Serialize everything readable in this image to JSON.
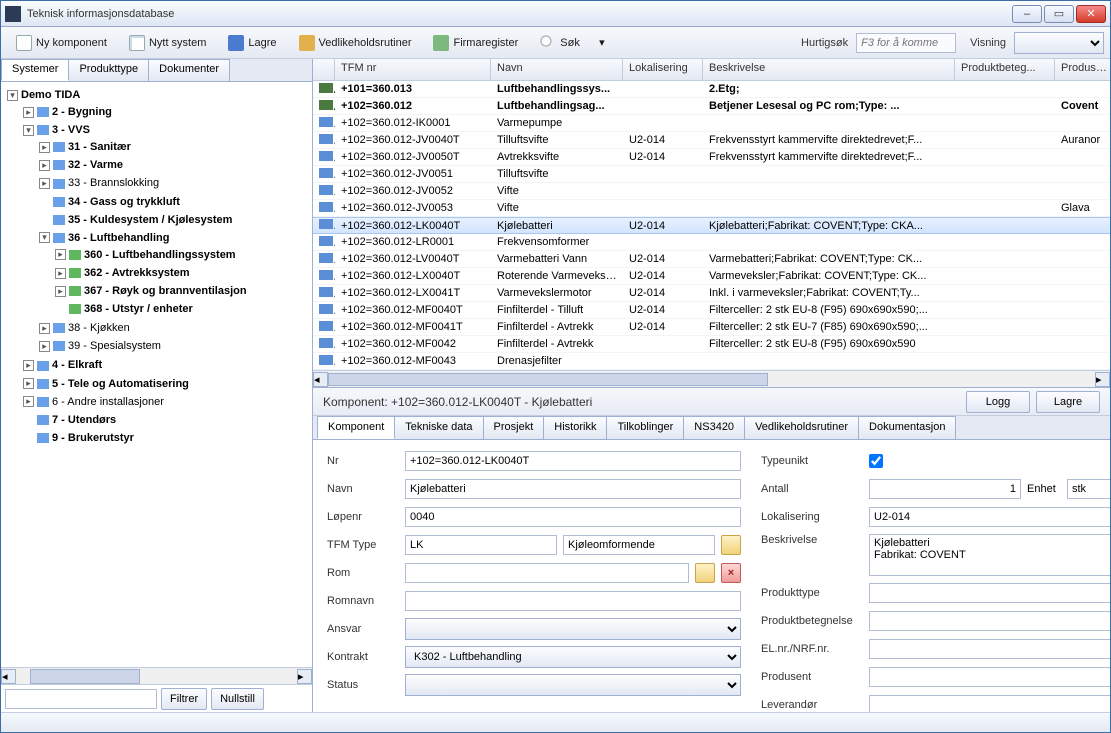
{
  "window": {
    "title": "Teknisk informasjonsdatabase"
  },
  "toolbar": {
    "new_component": "Ny komponent",
    "new_system": "Nytt system",
    "save": "Lagre",
    "maintenance": "Vedlikeholdsrutiner",
    "firm_register": "Firmaregister",
    "search": "Søk",
    "hurtigsok_label": "Hurtigsøk",
    "hurtigsok_placeholder": "F3 for å komme",
    "visning_label": "Visning"
  },
  "left_tabs": [
    "Systemer",
    "Produkttype",
    "Dokumenter"
  ],
  "tree": {
    "root": "Demo TIDA",
    "n2": "2 - Bygning",
    "n3": "3 - VVS",
    "n31": "31 - Sanitær",
    "n32": "32 - Varme",
    "n33": "33 - Brannslokking",
    "n34": "34 - Gass og trykkluft",
    "n35": "35 - Kuldesystem / Kjølesystem",
    "n36": "36 - Luftbehandling",
    "n360": "360 - Luftbehandlingssystem",
    "n362": "362 - Avtrekksystem",
    "n367": "367 - Røyk og brannventilasjon",
    "n368": "368 - Utstyr / enheter",
    "n38": "38 - Kjøkken",
    "n39": "39 - Spesialsystem",
    "n4": "4 - Elkraft",
    "n5": "5 - Tele og Automatisering",
    "n6": "6 - Andre installasjoner",
    "n7": "7 - Utendørs",
    "n9": "9 - Brukerutstyr"
  },
  "leftfoot": {
    "filter": "Filtrer",
    "reset": "Nullstill"
  },
  "grid": {
    "headers": {
      "tfm": "TFM nr",
      "navn": "Navn",
      "lok": "Lokalisering",
      "besk": "Beskrivelse",
      "prodb": "Produktbeteg...",
      "produ": "Produsent"
    },
    "rows": [
      {
        "sys": true,
        "tfm": "+101=360.013",
        "navn": "Luftbehandlingssys...",
        "lok": "",
        "besk": "2.Etg;",
        "produ": ""
      },
      {
        "sys": true,
        "tfm": "+102=360.012",
        "navn": "Luftbehandlingsag...",
        "lok": "",
        "besk": "Betjener Lesesal og PC rom;Type: ...",
        "produ": "Covent"
      },
      {
        "tfm": "+102=360.012-IK0001",
        "navn": "Varmepumpe",
        "lok": "",
        "besk": "",
        "produ": ""
      },
      {
        "tfm": "+102=360.012-JV0040T",
        "navn": "Tilluftsvifte",
        "lok": "U2-014",
        "besk": "Frekvensstyrt kammervifte direktedrevet;F...",
        "produ": "Auranor"
      },
      {
        "tfm": "+102=360.012-JV0050T",
        "navn": "Avtrekksvifte",
        "lok": "U2-014",
        "besk": "Frekvensstyrt kammervifte direktedrevet;F...",
        "produ": ""
      },
      {
        "tfm": "+102=360.012-JV0051",
        "navn": "Tilluftsvifte",
        "lok": "",
        "besk": "",
        "produ": ""
      },
      {
        "tfm": "+102=360.012-JV0052",
        "navn": "Vifte",
        "lok": "",
        "besk": "",
        "produ": ""
      },
      {
        "tfm": "+102=360.012-JV0053",
        "navn": "Vifte",
        "lok": "",
        "besk": "",
        "produ": "Glava"
      },
      {
        "sel": true,
        "tfm": "+102=360.012-LK0040T",
        "navn": "Kjølebatteri",
        "lok": "U2-014",
        "besk": "Kjølebatteri;Fabrikat: COVENT;Type: CKA...",
        "produ": ""
      },
      {
        "tfm": "+102=360.012-LR0001",
        "navn": "Frekvensomformer",
        "lok": "",
        "besk": "",
        "produ": ""
      },
      {
        "tfm": "+102=360.012-LV0040T",
        "navn": "Varmebatteri Vann",
        "lok": "U2-014",
        "besk": "Varmebatteri;Fabrikat: COVENT;Type: CK...",
        "produ": ""
      },
      {
        "tfm": "+102=360.012-LX0040T",
        "navn": "Roterende Varmeveksler",
        "lok": "U2-014",
        "besk": "Varmeveksler;Fabrikat: COVENT;Type: CK...",
        "produ": ""
      },
      {
        "tfm": "+102=360.012-LX0041T",
        "navn": "Varmevekslermotor",
        "lok": "U2-014",
        "besk": "Inkl. i varmeveksler;Fabrikat: COVENT;Ty...",
        "produ": ""
      },
      {
        "tfm": "+102=360.012-MF0040T",
        "navn": "Finfilterdel - Tilluft",
        "lok": "U2-014",
        "besk": "Filterceller: 2 stk EU-8 (F95) 690x690x590;...",
        "produ": ""
      },
      {
        "tfm": "+102=360.012-MF0041T",
        "navn": "Finfilterdel - Avtrekk",
        "lok": "U2-014",
        "besk": "Filterceller: 2 stk EU-7 (F85) 690x690x590;...",
        "produ": ""
      },
      {
        "tfm": "+102=360.012-MF0042",
        "navn": "Finfilterdel - Avtrekk",
        "lok": "",
        "besk": "Filterceller: 2 stk EU-8 (F95) 690x690x590",
        "produ": ""
      },
      {
        "tfm": "+102=360.012-MF0043",
        "navn": "Drenasjefilter",
        "lok": "",
        "besk": "",
        "produ": ""
      }
    ]
  },
  "detail": {
    "title": "Komponent: +102=360.012-LK0040T - Kjølebatteri",
    "logg": "Logg",
    "lagre": "Lagre",
    "tabs": [
      "Komponent",
      "Tekniske data",
      "Prosjekt",
      "Historikk",
      "Tilkoblinger",
      "NS3420",
      "Vedlikeholdsrutiner",
      "Dokumentasjon"
    ],
    "form": {
      "nr_label": "Nr",
      "nr": "+102=360.012-LK0040T",
      "navn_label": "Navn",
      "navn": "Kjølebatteri",
      "lopenr_label": "Løpenr",
      "lopenr": "0040",
      "tfmtype_label": "TFM Type",
      "tfmtype_code": "LK",
      "tfmtype_text": "Kjøleomformende",
      "rom_label": "Rom",
      "romnavn_label": "Romnavn",
      "ansvar_label": "Ansvar",
      "kontrakt_label": "Kontrakt",
      "kontrakt": "K302 - Luftbehandling",
      "status_label": "Status",
      "typeunikt_label": "Typeunikt",
      "antall_label": "Antall",
      "antall": "1",
      "enhet_label": "Enhet",
      "enhet": "stk",
      "lokalisering_label": "Lokalisering",
      "lokalisering": "U2-014",
      "beskrivelse_label": "Beskrivelse",
      "beskrivelse": "Kjølebatteri\nFabrikat: COVENT",
      "produkttype_label": "Produkttype",
      "prodbeteg_label": "Produktbetegnelse",
      "elnrf_label": "EL.nr./NRF.nr.",
      "produsent_label": "Produsent",
      "leverandor_label": "Leverandør"
    }
  }
}
